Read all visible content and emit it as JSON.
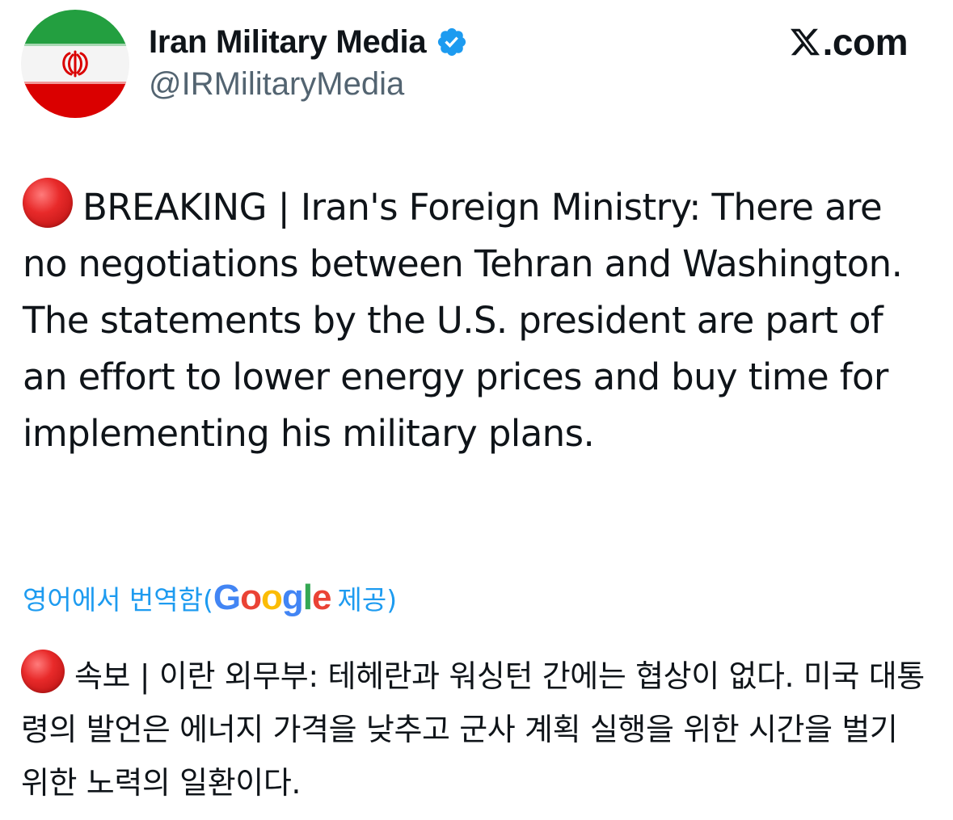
{
  "author": {
    "display_name": "Iran Military Media",
    "handle": "@IRMilitaryMedia",
    "verified": true,
    "avatar_icon": "iran-flag-avatar"
  },
  "site_label": {
    "logo_icon": "x-logo-icon",
    "text": ".com"
  },
  "tweet": {
    "emoji_icon": "red-circle-emoji",
    "text": "BREAKING | Iran's Foreign Ministry: There are no negotiations between Tehran and Washington. The statements by the U.S. president are part of an effort to lower energy prices and buy time for implementing his military plans."
  },
  "translation": {
    "prefix": "영어에서 번역함(",
    "google_letters": [
      "G",
      "o",
      "o",
      "g",
      "l",
      "e"
    ],
    "suffix": " 제공)",
    "emoji_icon": "red-circle-emoji",
    "text": "속보 | 이란 외무부: 테헤란과 워싱턴 간에는 협상이 없다. 미국 대통령의 발언은 에너지 가격을 낮추고 군사 계획 실행을 위한 시간을 벌기 위한 노력의 일환이다."
  },
  "colors": {
    "accent": "#1d9bf0",
    "text_primary": "#0f1419",
    "text_secondary": "#536471",
    "flag_green": "#239f40",
    "flag_red": "#da0000",
    "emblem_red": "#da0000"
  }
}
